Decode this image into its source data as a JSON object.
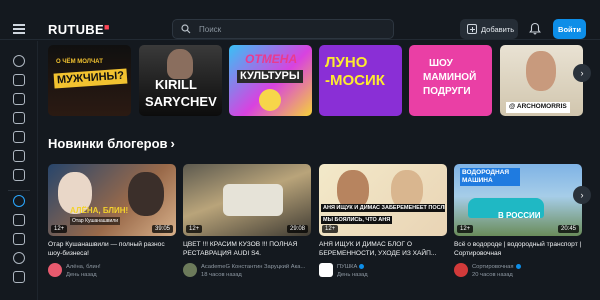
{
  "header": {
    "logo": "RUTUBE",
    "search_placeholder": "Поиск",
    "add_label": "Добавить",
    "login_label": "Войти"
  },
  "shelf": {
    "items": [
      {
        "line1": "О ЧЁМ МОЛЧАТ",
        "line2": "МУЖЧИНЫ?"
      },
      {
        "line1": "KIRILL",
        "line2": "SARYCHEV"
      },
      {
        "line1": "ОТМЕНА",
        "line2": "КУЛЬТУРЫ"
      },
      {
        "line1": "ЛУНО",
        "line2": "-МОСИК"
      },
      {
        "line1": "ШОУ",
        "line2": "МАМИНОЙ",
        "line3": "ПОДРУГИ"
      },
      {
        "line1": "",
        "line2": "",
        "handle": "@ ARCHOMORRIS"
      }
    ]
  },
  "section": {
    "title": "Новинки блогеров",
    "chevron": "›"
  },
  "videos": [
    {
      "title": "Отар Кушанашвили — полный разнос шоу-бизнеса!",
      "channel": "Алёна, блин!",
      "time": "День назад",
      "age": "12+",
      "duration": "39:05",
      "overlay": "АЛЁНА, БЛИН!",
      "overlay_sub": "Отар Кушанашвили"
    },
    {
      "title": "ЦВЕТ !!! КРАСИМ КУЗОВ !!! ПОЛНАЯ РЕСТАВРАЦИЯ AUDI S4.",
      "channel": "AcademeG Константин Заруцкий Ака...",
      "time": "18 часов назад",
      "age": "12+",
      "duration": "29:08"
    },
    {
      "title": "АНЯ ИЩУК И ДИМАС БЛОГ О БЕРЕМЕННОСТИ, УХОДЕ ИЗ ХАЙП...",
      "channel": "ПУШКА",
      "time": "День назад",
      "age": "12+",
      "duration": "",
      "overlay": "АНЯ ИЩУК И ДИМАС ЗАБЕРЕМЕНЕЕТ ПОСЛЕ ВЫКИ...",
      "overlay_sub": "МЫ БОЯЛИСЬ, ЧТО АНЯ"
    },
    {
      "title": "Всё о водороде | водородный транспорт | Сортировочная",
      "channel": "Сортировочная",
      "time": "20 часов назад",
      "age": "12+",
      "duration": "20:45",
      "overlay": "ВОДОРОДНАЯ МАШИНА",
      "overlay_sub": "В РОССИИ"
    }
  ],
  "colors": {
    "background": "#14191f",
    "accent": "#0d8ee8",
    "logo_dot": "#ff4657"
  }
}
